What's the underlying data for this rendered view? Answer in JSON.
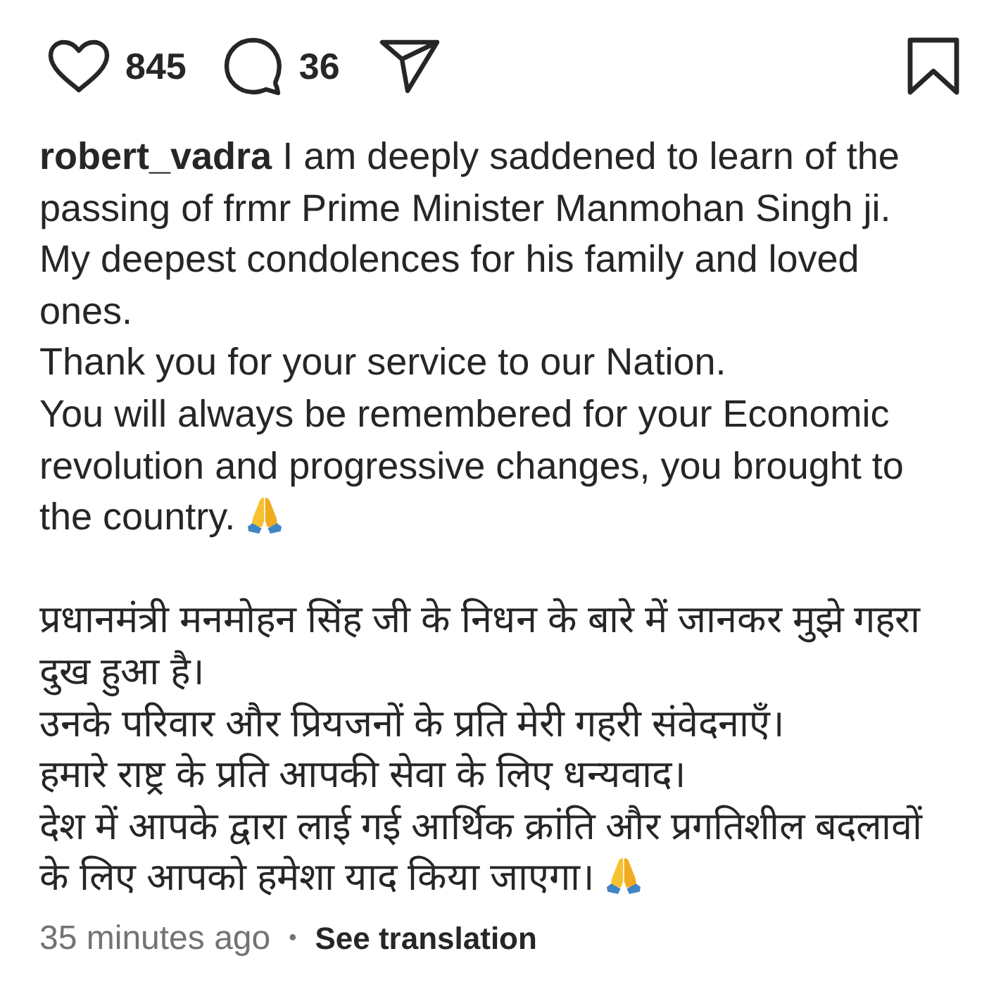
{
  "actions": {
    "liked": false,
    "likes": "845",
    "comments": "36",
    "saved": false
  },
  "caption": {
    "username": "robert_vadra",
    "paragraphs": [
      {
        "lines": [
          "I am deeply saddened to learn of the passing of frmr Prime Minister Manmohan Singh ji.",
          "My deepest condolences for his family and loved ones.",
          "Thank you for your service to our Nation.",
          "You will always be remembered for your Economic revolution and progressive changes, you brought to the country."
        ]
      },
      {
        "lines": [
          "प्रधानमंत्री मनमोहन सिंह जी के निधन के बारे में जानकर मुझे गहरा दुख हुआ है।",
          "उनके परिवार और प्रियजनों के प्रति मेरी गहरी संवेदनाएँ।",
          "हमारे राष्ट्र के प्रति आपकी सेवा के लिए धन्यवाद।",
          "देश में आपके द्वारा लाई गई आर्थिक क्रांति और प्रगतिशील बदलावों के लिए आपको हमेशा याद किया जाएगा।"
        ]
      }
    ]
  },
  "footer": {
    "time": "35 minutes ago",
    "separator": "•",
    "translation_link": "See translation"
  }
}
